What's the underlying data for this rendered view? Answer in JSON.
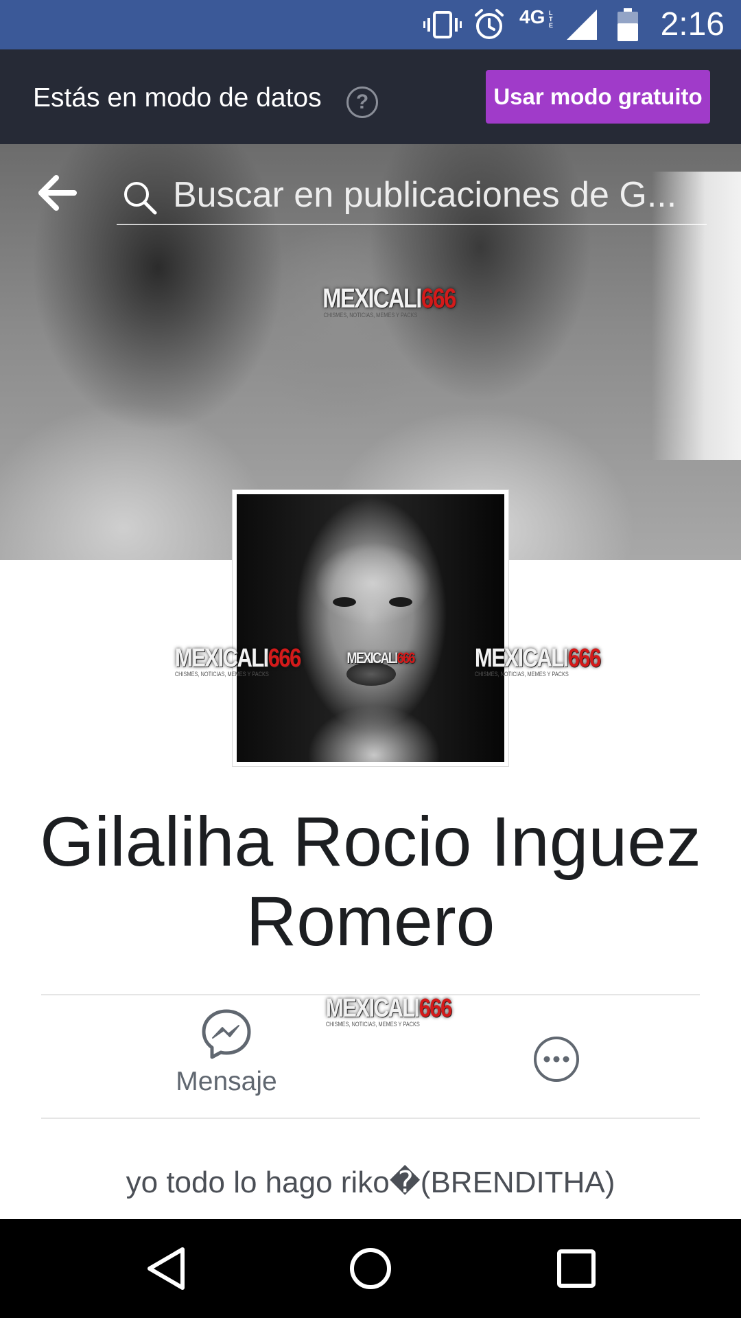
{
  "status_bar": {
    "time": "2:16",
    "network_label": "4G",
    "icons": [
      "vibrate-icon",
      "alarm-icon",
      "lte-4g-icon",
      "signal-icon",
      "battery-icon"
    ]
  },
  "data_banner": {
    "message": "Estás en modo de datos",
    "help_glyph": "?",
    "button_label": "Usar modo gratuito"
  },
  "search": {
    "placeholder": "Buscar en publicaciones de G..."
  },
  "watermark": {
    "brand": "MEXICALI",
    "number": "666",
    "tagline": "CHISMES, NOTICIAS, MEMES Y PACKS"
  },
  "profile": {
    "name": "Gilaliha Rocio Inguez Romero",
    "bio": "yo todo lo hago riko�(BRENDITHA)"
  },
  "actions": {
    "message_label": "Mensaje"
  },
  "colors": {
    "status_bar": "#3b5998",
    "banner_bg": "#262a36",
    "free_button": "#a03bc9",
    "name_text": "#1c1e21",
    "muted_text": "#606770",
    "watermark_red": "#d41a1a"
  }
}
